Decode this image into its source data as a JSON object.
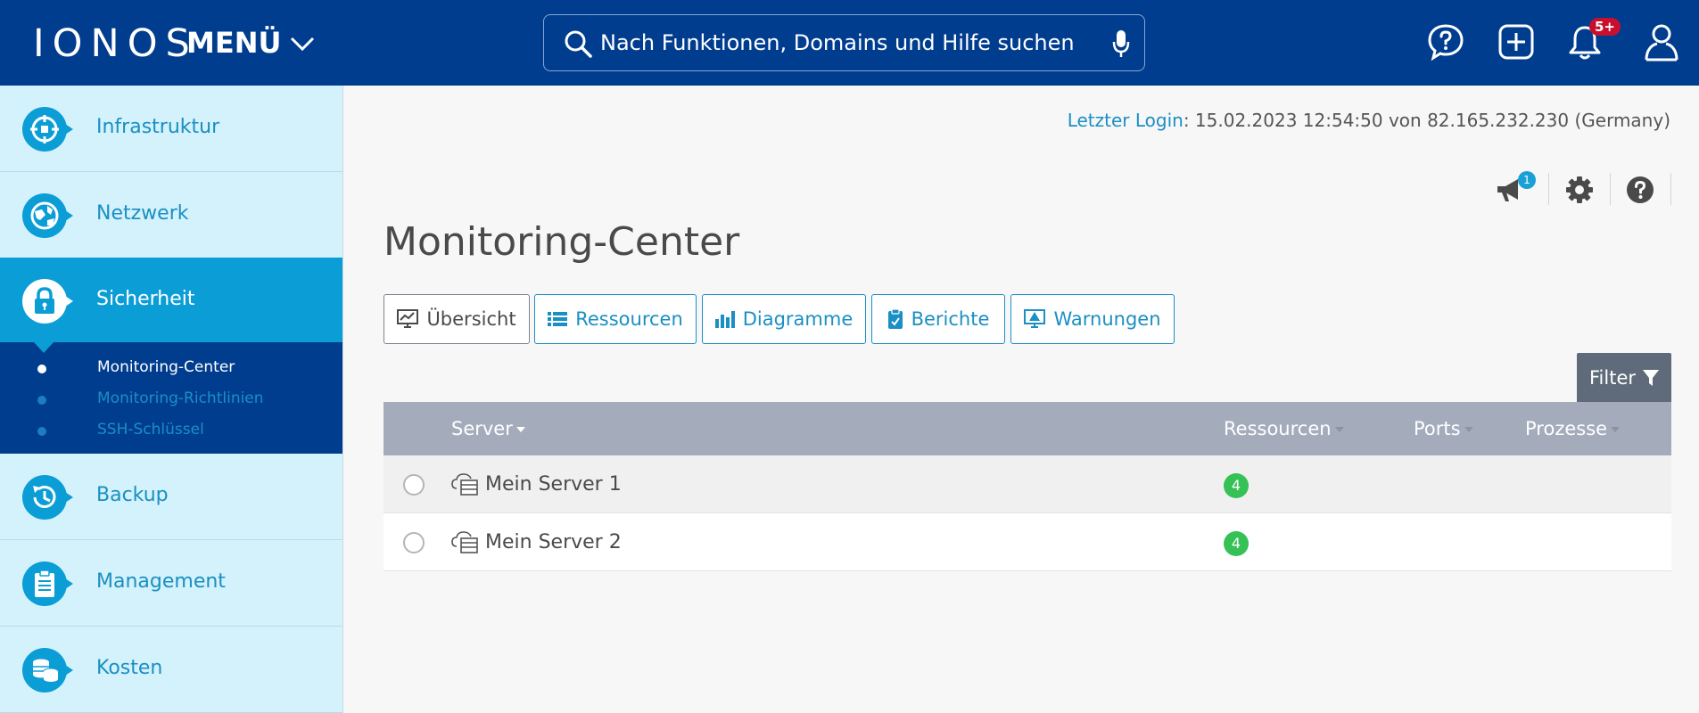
{
  "header": {
    "logo": "IONOS",
    "menu_label": "MENÜ",
    "search_placeholder": "Nach Funktionen, Domains und Hilfe suchen",
    "notification_badge": "5+"
  },
  "sidebar": {
    "items": [
      {
        "label": "Infrastruktur",
        "icon": "infrastructure-icon"
      },
      {
        "label": "Netzwerk",
        "icon": "network-globe-icon"
      },
      {
        "label": "Sicherheit",
        "icon": "lock-icon"
      },
      {
        "label": "Backup",
        "icon": "backup-clock-icon"
      },
      {
        "label": "Management",
        "icon": "clipboard-icon"
      },
      {
        "label": "Kosten",
        "icon": "coins-icon"
      }
    ],
    "submenu": [
      {
        "label": "Monitoring-Center"
      },
      {
        "label": "Monitoring-Richtlinien"
      },
      {
        "label": "SSH-Schlüssel"
      }
    ]
  },
  "main": {
    "last_login_label": "Letzter Login",
    "last_login_value": ": 15.02.2023 12:54:50 von 82.165.232.230 (Germany)",
    "announcement_badge": "1",
    "title": "Monitoring-Center",
    "tabs": [
      {
        "label": "Übersicht",
        "icon": "monitor-chart-icon"
      },
      {
        "label": "Ressourcen",
        "icon": "list-icon"
      },
      {
        "label": "Diagramme",
        "icon": "bar-chart-icon"
      },
      {
        "label": "Berichte",
        "icon": "report-clipboard-icon"
      },
      {
        "label": "Warnungen",
        "icon": "alert-monitor-icon"
      }
    ],
    "filter_label": "Filter",
    "table": {
      "headers": [
        "Server",
        "Ressourcen",
        "Ports",
        "Prozesse"
      ],
      "rows": [
        {
          "name": "Mein Server 1",
          "resources": "4"
        },
        {
          "name": "Mein Server 2",
          "resources": "4"
        }
      ]
    }
  },
  "colors": {
    "header_bg": "#003d8f",
    "sidebar_bg": "#d3f2fb",
    "accent": "#0b9dd6",
    "table_header": "#a4acbc",
    "badge_green": "#35c155"
  }
}
